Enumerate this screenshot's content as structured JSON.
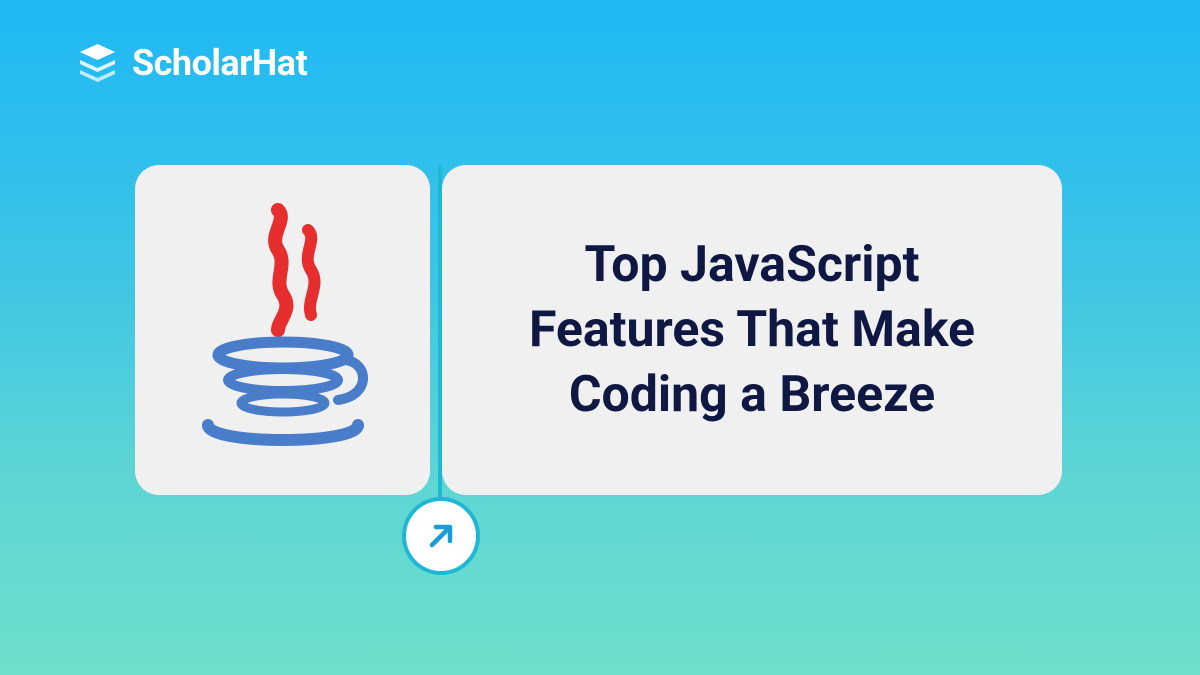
{
  "logo": {
    "text": "ScholarHat"
  },
  "title": "Top JavaScript Features That Make Coding a Breeze",
  "colors": {
    "primary_text": "#0f1743",
    "accent": "#1eb8d5",
    "card_bg": "#f0f0f0",
    "white": "#ffffff",
    "java_red": "#e62e2e",
    "java_blue": "#4a7dc9"
  },
  "icons": {
    "logo": "layers-icon",
    "arrow": "arrow-up-right-icon",
    "main_image": "java-logo"
  }
}
